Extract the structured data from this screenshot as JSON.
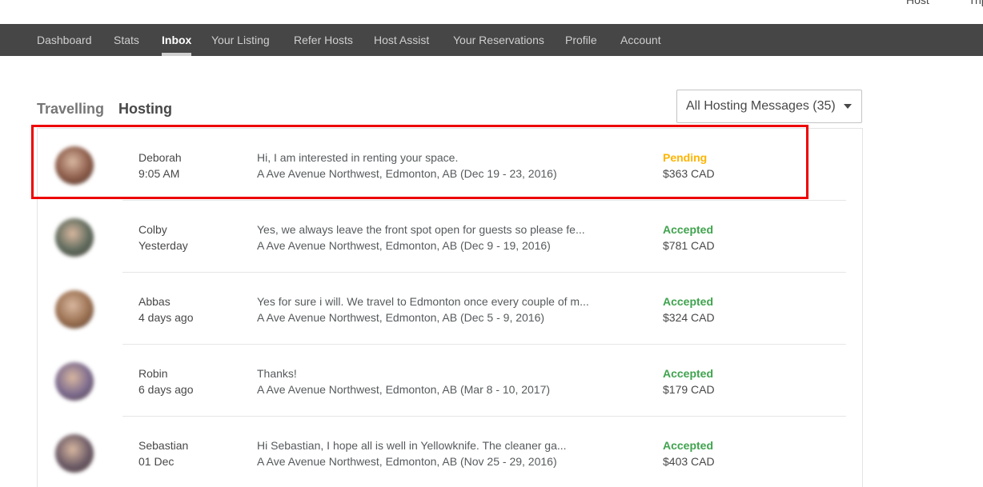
{
  "top_links": [
    "Host",
    "Trip"
  ],
  "nav": {
    "items": [
      {
        "label": "Dashboard",
        "active": false
      },
      {
        "label": "Stats",
        "active": false
      },
      {
        "label": "Inbox",
        "active": true
      },
      {
        "label": "Your Listing",
        "active": false
      },
      {
        "label": "Refer Hosts",
        "active": false
      },
      {
        "label": "Host Assist",
        "active": false
      },
      {
        "label": "Your Reservations",
        "active": false
      },
      {
        "label": "Profile",
        "active": false
      },
      {
        "label": "Account",
        "active": false
      }
    ]
  },
  "tabs": {
    "travelling": "Travelling",
    "hosting": "Hosting"
  },
  "filter": {
    "selected": "All Hosting Messages (35)"
  },
  "colors": {
    "pending": "#ffb400",
    "accepted": "#3fa34d",
    "highlight": "#ee0000"
  },
  "messages": [
    {
      "name": "Deborah",
      "time": "9:05 AM",
      "message": "Hi, I am interested in renting your space.",
      "location": "A Ave Avenue Northwest, Edmonton, AB (Dec 19 - 23, 2016)",
      "status": "Pending",
      "price": "$363 CAD",
      "avatar_color": "#8a5a48"
    },
    {
      "name": "Colby",
      "time": "Yesterday",
      "message": "Yes, we always leave the front spot open for guests so please fe...",
      "location": "A Ave Avenue Northwest, Edmonton, AB (Dec 9 - 19, 2016)",
      "status": "Accepted",
      "price": "$781 CAD",
      "avatar_color": "#5d6a5c"
    },
    {
      "name": "Abbas",
      "time": "4 days ago",
      "message": "Yes for sure i will. We travel to Edmonton once every couple of m...",
      "location": "A Ave Avenue Northwest, Edmonton, AB (Dec 5 - 9, 2016)",
      "status": "Accepted",
      "price": "$324 CAD",
      "avatar_color": "#9a6f50"
    },
    {
      "name": "Robin",
      "time": "6 days ago",
      "message": "Thanks!",
      "location": "A Ave Avenue Northwest, Edmonton, AB (Mar 8 - 10, 2017)",
      "status": "Accepted",
      "price": "$179 CAD",
      "avatar_color": "#7b6a8e"
    },
    {
      "name": "Sebastian",
      "time": "01 Dec",
      "message": "Hi Sebastian, I hope all is well in Yellowknife. The cleaner ga...",
      "location": "A Ave Avenue Northwest, Edmonton, AB (Nov 25 - 29, 2016)",
      "status": "Accepted",
      "price": "$403 CAD",
      "avatar_color": "#6b5a66"
    }
  ]
}
